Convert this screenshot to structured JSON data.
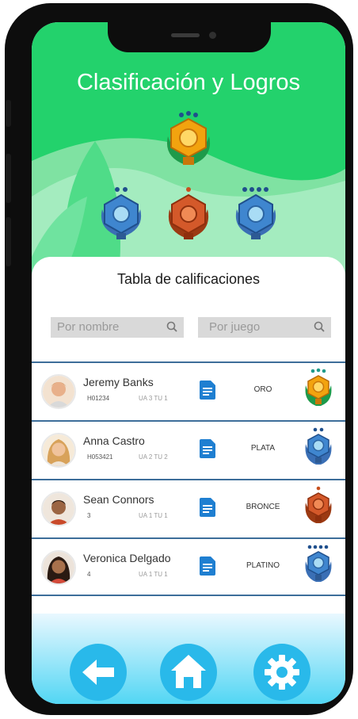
{
  "header": {
    "title": "Clasificación y Logros"
  },
  "leaderboard": {
    "title": "Tabla de calificaciones",
    "search_by_name_placeholder": "Por nombre",
    "search_by_game_placeholder": "Por juego"
  },
  "rows": [
    {
      "name": "Jeremy Banks",
      "code": "H01234",
      "unit": "UA 3  TU 1",
      "rank": "ORO",
      "medal": "gold"
    },
    {
      "name": "Anna Castro",
      "code": "H053421",
      "unit": "UA 2  TU 2",
      "rank": "PLATA",
      "medal": "silver"
    },
    {
      "name": "Sean Connors",
      "code": "3",
      "unit": "UA 1  TU 1",
      "rank": "BRONCE",
      "medal": "bronze"
    },
    {
      "name": "Veronica Delgado",
      "code": "4",
      "unit": "UA 1  TU 1",
      "rank": "PLATINO",
      "medal": "platinum"
    }
  ],
  "nav": {
    "back": "arrow-left-icon",
    "home": "home-icon",
    "settings": "gear-icon"
  },
  "colors": {
    "header_green": "#23d26c",
    "divider_blue": "#3d6e9a",
    "nav_blue": "#29b9ea",
    "gold": "#f2a30f",
    "bronze": "#c8501e",
    "silver": "#3a78b8"
  }
}
